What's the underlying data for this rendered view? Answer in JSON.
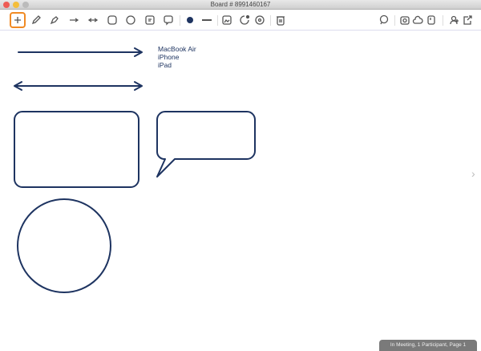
{
  "window": {
    "title": "Board # 8991460167"
  },
  "toolbar": {
    "left": [
      "move-icon",
      "pencil-icon",
      "pen-icon",
      "arrow-icon",
      "double-arrow-icon",
      "rounded-rect-icon",
      "circle-icon",
      "note-icon",
      "speech-bubble-icon",
      "color-dot-icon",
      "line-width-icon",
      "image-icon",
      "stamp-icon",
      "settings-icon",
      "trash-icon"
    ],
    "right": [
      "chat-icon",
      "camera-icon",
      "cloud-icon",
      "document-icon",
      "participants-icon",
      "share-icon"
    ]
  },
  "board": {
    "text_lines": [
      "MacBook Air",
      "iPhone",
      "iPad"
    ],
    "stroke_color": "#1e3461"
  },
  "status": "In Meeting, 1 Participant, Page 1",
  "colors": {
    "accent": "#f08a24"
  }
}
